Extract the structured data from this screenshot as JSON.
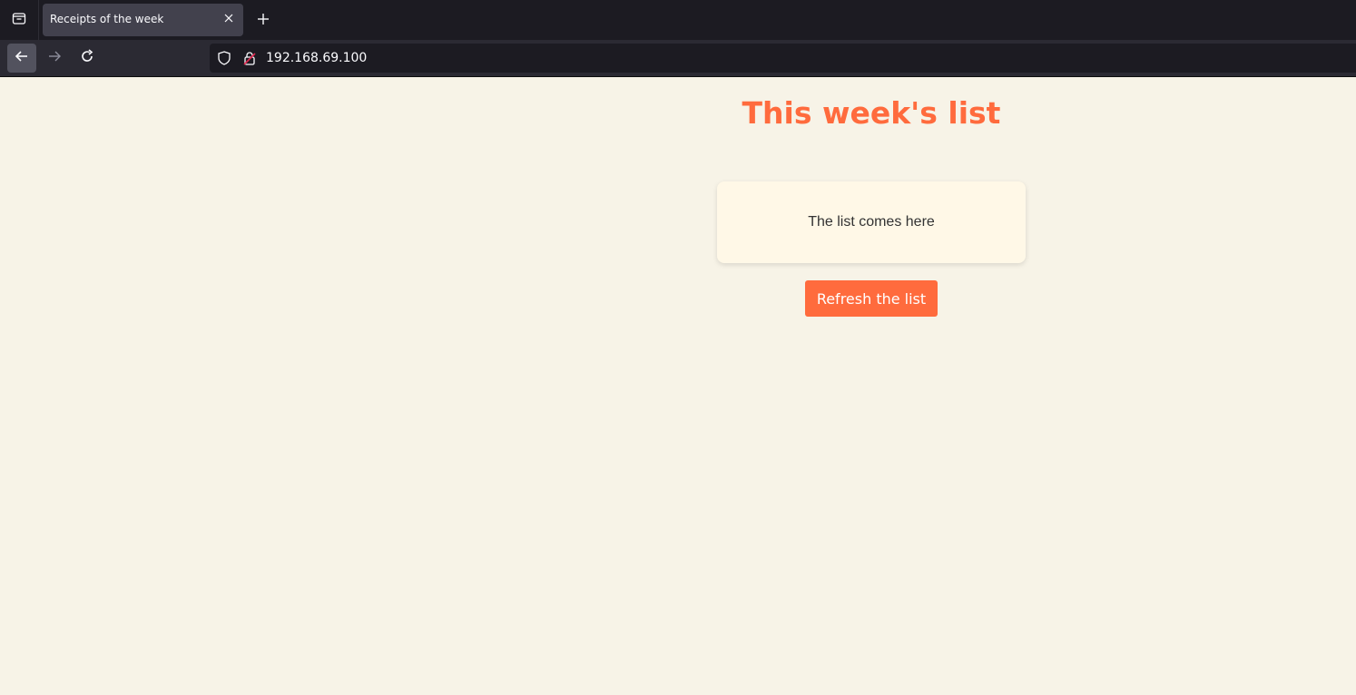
{
  "browser": {
    "tab": {
      "title": "Receipts of the week",
      "close_icon": "close-icon"
    },
    "tab_list_icon": "tab-list-icon",
    "new_tab_icon": "plus-icon",
    "nav": {
      "back_icon": "arrow-left-icon",
      "forward_icon": "arrow-right-icon",
      "reload_icon": "reload-icon"
    },
    "urlbar": {
      "shield_icon": "shield-icon",
      "lock_icon": "insecure-lock-icon",
      "url": "192.168.69.100"
    }
  },
  "page": {
    "title": "This week's list",
    "list_placeholder": "The list comes here",
    "refresh_button_label": "Refresh the list"
  },
  "colors": {
    "accent": "#ff6b3d",
    "page_background": "#f7f3e7",
    "card_background": "#fff8e7"
  }
}
